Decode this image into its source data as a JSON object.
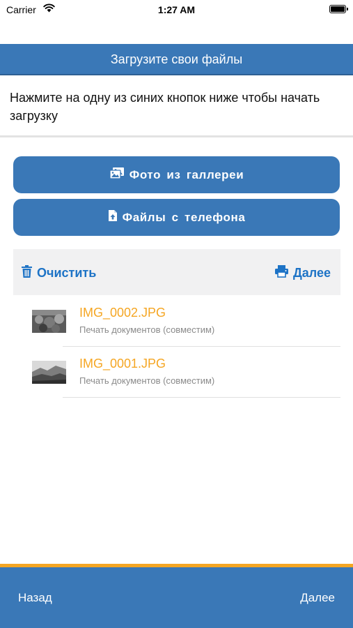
{
  "status_bar": {
    "carrier": "Carrier",
    "time": "1:27 AM"
  },
  "nav": {
    "title": "Загрузите свои файлы"
  },
  "instruction": "Нажмите на одну из синих кнопок ниже чтобы начать загрузку",
  "buttons": {
    "gallery": "Фото из галлереи",
    "files": "Файлы с телефона"
  },
  "toolbar": {
    "clear": "Очистить",
    "next": "Далее"
  },
  "files": [
    {
      "name": "IMG_0002.JPG",
      "description": "Печать документов (совместим)"
    },
    {
      "name": "IMG_0001.JPG",
      "description": "Печать документов (совместим)"
    }
  ],
  "bottom_bar": {
    "back": "Назад",
    "next": "Далее"
  },
  "colors": {
    "primary": "#3a78b7",
    "accent": "#f5a623",
    "link": "#1d73c6"
  }
}
